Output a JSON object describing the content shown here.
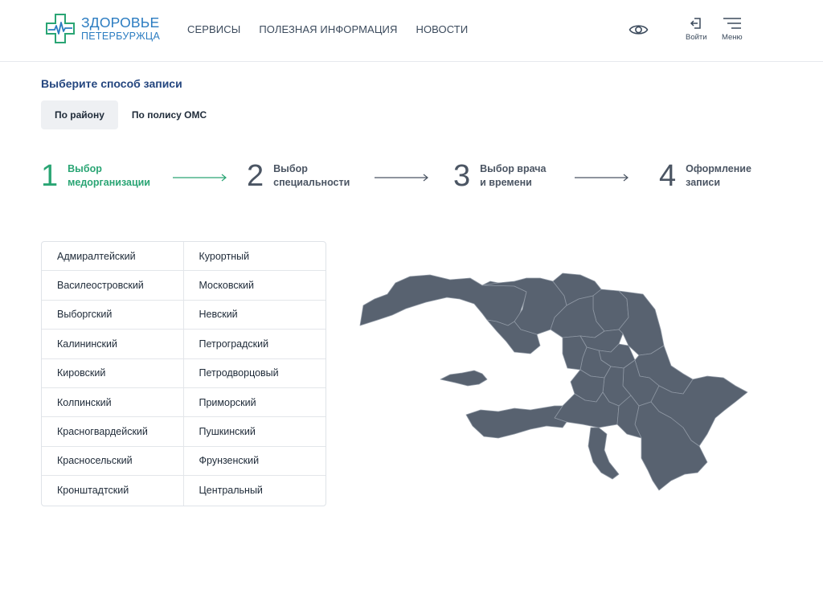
{
  "header": {
    "logo_line1": "ЗДОРОВЬЕ",
    "logo_line2": "ПЕТЕРБУРЖЦА",
    "nav": [
      "СЕРВИСЫ",
      "ПОЛЕЗНАЯ ИНФОРМАЦИЯ",
      "НОВОСТИ"
    ],
    "login_label": "Войти",
    "menu_label": "Меню"
  },
  "choose": {
    "title": "Выберите способ записи",
    "tabs": [
      "По району",
      "По полису ОМС"
    ],
    "active_tab": "По району"
  },
  "steps": [
    {
      "num": "1",
      "line1": "Выбор",
      "line2": "медорганизации",
      "active": true
    },
    {
      "num": "2",
      "line1": "Выбор",
      "line2": "специальности",
      "active": false
    },
    {
      "num": "3",
      "line1": "Выбор врача",
      "line2": "и времени",
      "active": false
    },
    {
      "num": "4",
      "line1": "Оформление",
      "line2": "записи",
      "active": false
    }
  ],
  "districts": {
    "left": [
      "Адмиралтейский",
      "Василеостровский",
      "Выборгский",
      "Калининский",
      "Кировский",
      "Колпинский",
      "Красногвардейский",
      "Красносельский",
      "Кронштадтский"
    ],
    "right": [
      "Курортный",
      "Московский",
      "Невский",
      "Петроградский",
      "Петродворцовый",
      "Приморский",
      "Пушкинский",
      "Фрунзенский",
      "Центральный"
    ]
  },
  "colors": {
    "brand_blue": "#2b7cc1",
    "brand_green": "#2aa574",
    "title_blue": "#24467f",
    "map_fill": "#586270"
  },
  "icons": [
    "heart-pulse-logo-icon",
    "eye-icon",
    "login-icon",
    "hamburger-menu-icon",
    "arrow-right-icon"
  ]
}
